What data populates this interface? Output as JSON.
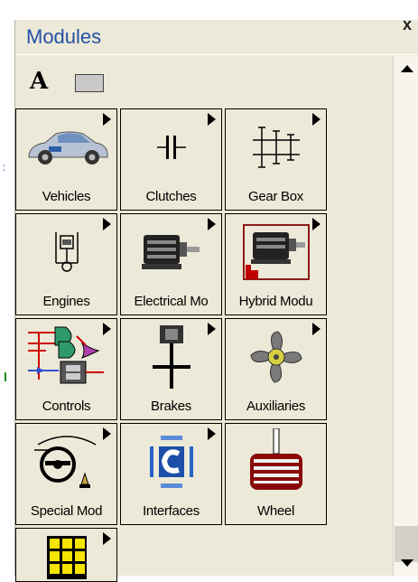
{
  "panel": {
    "title": "Modules",
    "close_label": "x"
  },
  "toolbar": {
    "text_tool_label": "A"
  },
  "modules": [
    {
      "label": "Vehicles",
      "icon": "car-icon",
      "has_submenu": true
    },
    {
      "label": "Clutches",
      "icon": "clutch-icon",
      "has_submenu": true
    },
    {
      "label": "Gear Box",
      "icon": "gearbox-icon",
      "has_submenu": true
    },
    {
      "label": "Engines",
      "icon": "engine-icon",
      "has_submenu": true
    },
    {
      "label": "Electrical Mo",
      "icon": "electric-motor-icon",
      "has_submenu": true
    },
    {
      "label": "Hybrid Modu",
      "icon": "hybrid-motor-icon",
      "has_submenu": true
    },
    {
      "label": "Controls",
      "icon": "logic-gates-icon",
      "has_submenu": true
    },
    {
      "label": "Brakes",
      "icon": "brake-icon",
      "has_submenu": true
    },
    {
      "label": "Auxiliaries",
      "icon": "fan-icon",
      "has_submenu": true
    },
    {
      "label": "Special Mod",
      "icon": "steering-wheel-icon",
      "has_submenu": true
    },
    {
      "label": "Interfaces",
      "icon": "interface-c-icon",
      "has_submenu": true
    },
    {
      "label": "Wheel",
      "icon": "wheel-icon",
      "has_submenu": false
    },
    {
      "label": "",
      "icon": "yellow-grid-icon",
      "has_submenu": true
    }
  ],
  "colors": {
    "title": "#2350a6",
    "panel_bg": "#ece9d8"
  }
}
